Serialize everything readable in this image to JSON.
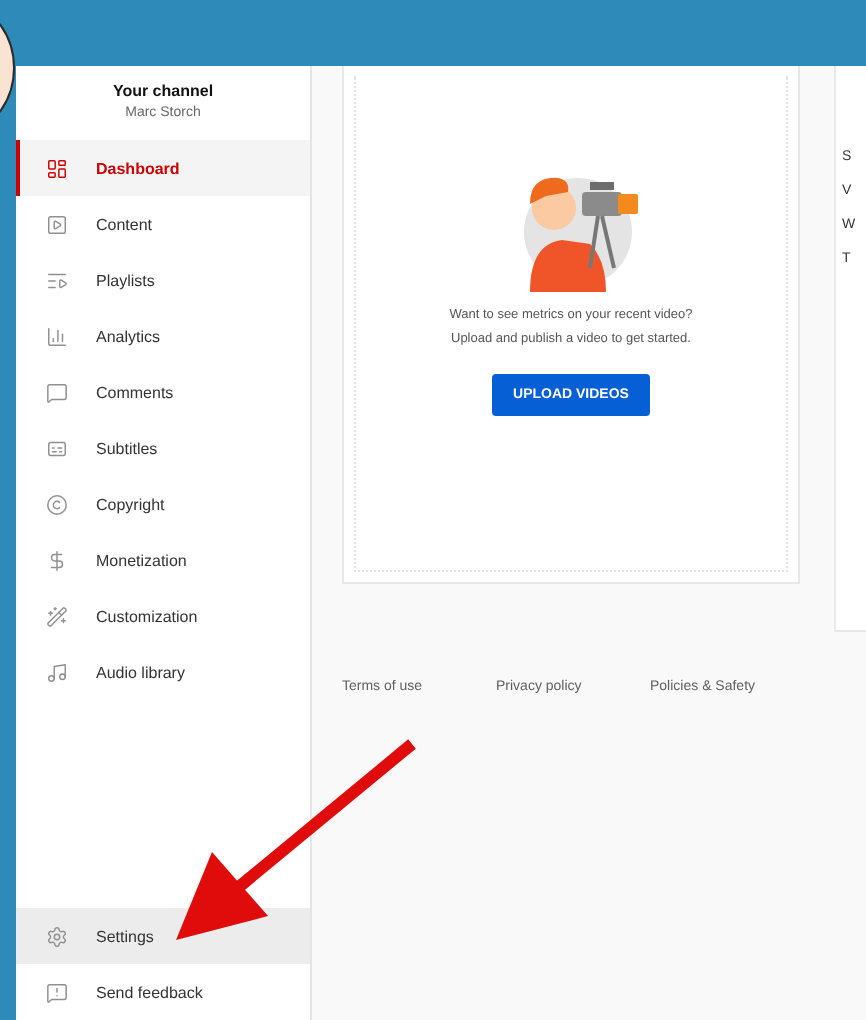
{
  "channel": {
    "title": "Your channel",
    "name": "Marc Storch"
  },
  "nav": [
    {
      "label": "Dashboard",
      "selected": true,
      "hovered": false
    },
    {
      "label": "Content",
      "selected": false,
      "hovered": false
    },
    {
      "label": "Playlists",
      "selected": false,
      "hovered": false
    },
    {
      "label": "Analytics",
      "selected": false,
      "hovered": false
    },
    {
      "label": "Comments",
      "selected": false,
      "hovered": false
    },
    {
      "label": "Subtitles",
      "selected": false,
      "hovered": false
    },
    {
      "label": "Copyright",
      "selected": false,
      "hovered": false
    },
    {
      "label": "Monetization",
      "selected": false,
      "hovered": false
    },
    {
      "label": "Customization",
      "selected": false,
      "hovered": false
    },
    {
      "label": "Audio library",
      "selected": false,
      "hovered": false
    }
  ],
  "nav_bottom": [
    {
      "label": "Settings",
      "selected": false,
      "hovered": true
    },
    {
      "label": "Send feedback",
      "selected": false,
      "hovered": false
    }
  ],
  "video_card": {
    "message": [
      "Want to see metrics on your recent video?",
      "Upload and publish a video to get started."
    ],
    "button": "UPLOAD VIDEOS"
  },
  "side_card": {
    "lines": [
      "S",
      "V",
      "W",
      "T"
    ]
  },
  "footer_links": [
    "Terms of use",
    "Privacy policy",
    "Policies & Safety"
  ]
}
